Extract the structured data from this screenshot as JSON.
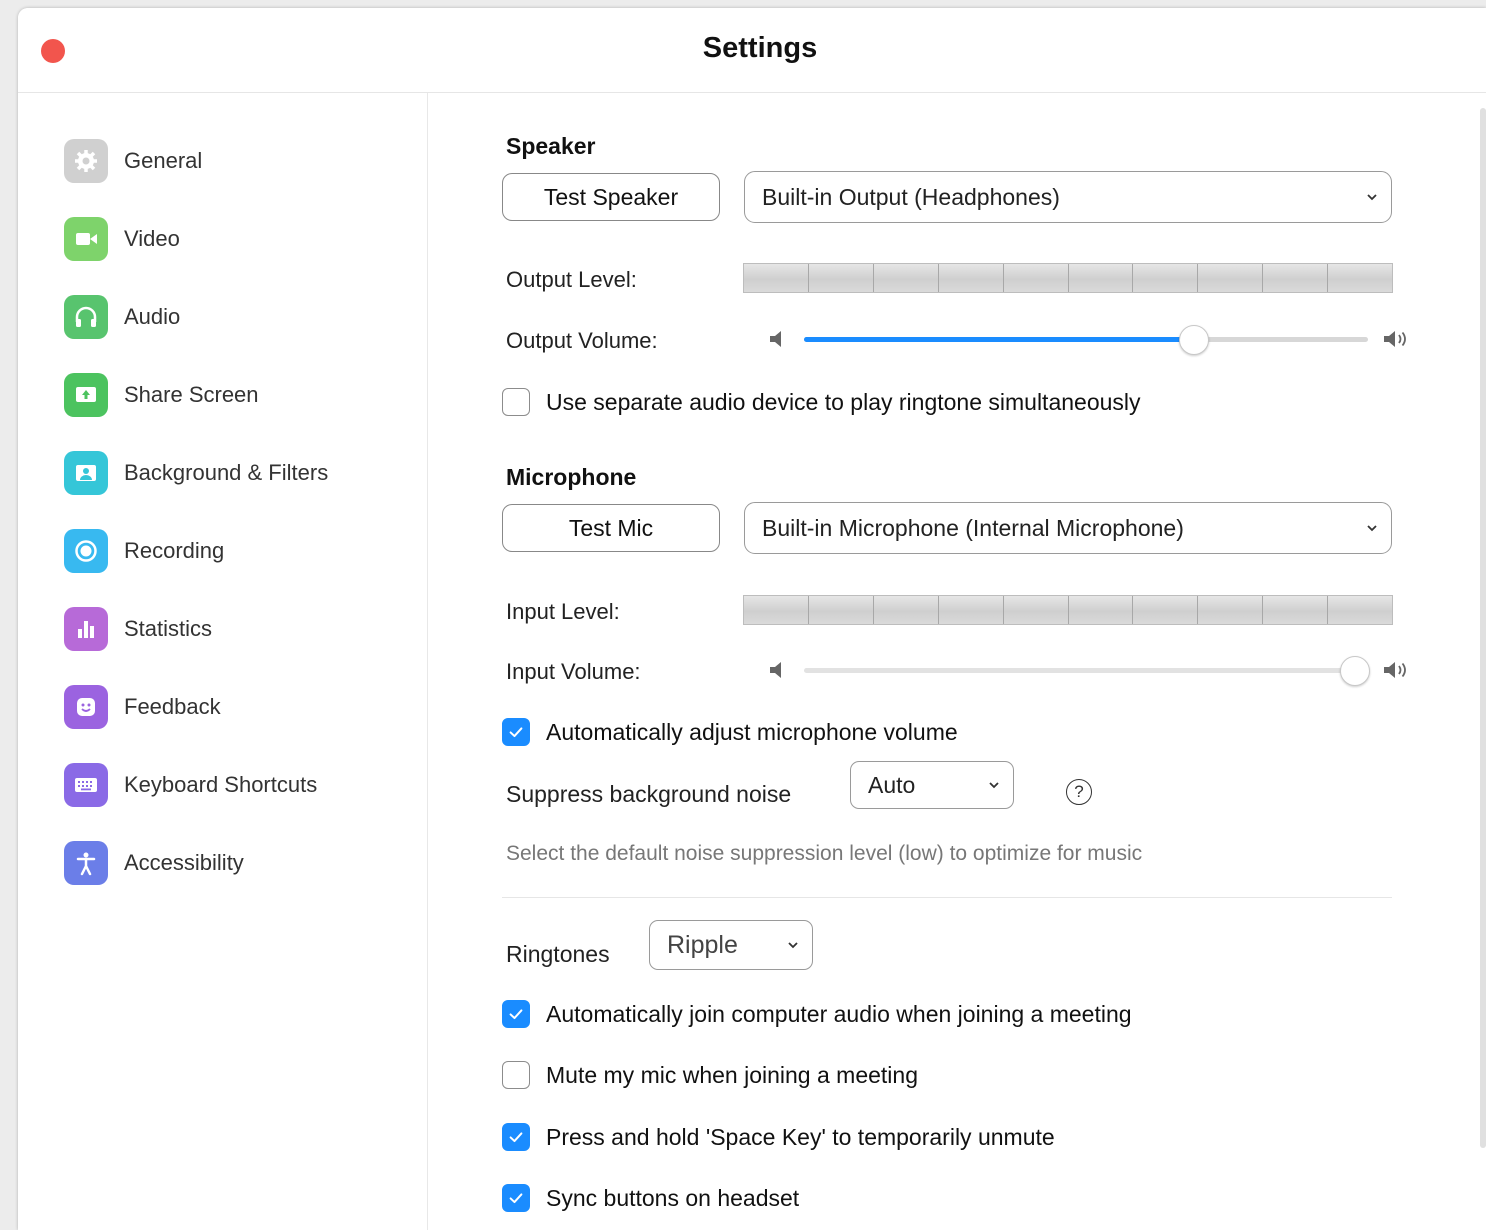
{
  "window": {
    "title": "Settings",
    "close_color": "#f2554d"
  },
  "sidebar": {
    "items": [
      {
        "label": "General",
        "icon": "gear-icon",
        "color": "#c9c9c9"
      },
      {
        "label": "Video",
        "icon": "video-camera-icon",
        "color": "#7ed36b"
      },
      {
        "label": "Audio",
        "icon": "headphones-icon",
        "color": "#58c46e"
      },
      {
        "label": "Share Screen",
        "icon": "share-screen-icon",
        "color": "#4cc35f"
      },
      {
        "label": "Background & Filters",
        "icon": "background-icon",
        "color": "#35c6d8"
      },
      {
        "label": "Recording",
        "icon": "recording-icon",
        "color": "#38b9f0"
      },
      {
        "label": "Statistics",
        "icon": "statistics-icon",
        "color": "#b76ad8"
      },
      {
        "label": "Feedback",
        "icon": "feedback-icon",
        "color": "#9b63e0"
      },
      {
        "label": "Keyboard Shortcuts",
        "icon": "keyboard-icon",
        "color": "#8a6ae6"
      },
      {
        "label": "Accessibility",
        "icon": "accessibility-icon",
        "color": "#6b7ee8"
      }
    ]
  },
  "speaker": {
    "title": "Speaker",
    "test_label": "Test Speaker",
    "device": "Built-in Output (Headphones)",
    "output_level_label": "Output Level:",
    "output_volume_label": "Output Volume:",
    "output_volume": 0.69,
    "separate_device_label": "Use separate audio device to play ringtone simultaneously",
    "separate_device_checked": false
  },
  "microphone": {
    "title": "Microphone",
    "test_label": "Test Mic",
    "device": "Built-in Microphone (Internal Microphone)",
    "input_level_label": "Input Level:",
    "input_volume_label": "Input Volume:",
    "input_volume": 0.975,
    "auto_adjust_label": "Automatically adjust microphone volume",
    "auto_adjust_checked": true,
    "suppress_label": "Suppress background noise",
    "suppress_value": "Auto",
    "help_glyph": "?",
    "suppress_hint": "Select the default noise suppression level (low) to optimize for music"
  },
  "ringtones": {
    "label": "Ringtones",
    "value": "Ripple"
  },
  "options": [
    {
      "label": "Automatically join computer audio when joining a meeting",
      "checked": true
    },
    {
      "label": "Mute my mic when joining a meeting",
      "checked": false
    },
    {
      "label": "Press and hold 'Space Key' to temporarily unmute",
      "checked": true
    },
    {
      "label": "Sync buttons on headset",
      "checked": true
    }
  ],
  "accent_color": "#1a8cff"
}
